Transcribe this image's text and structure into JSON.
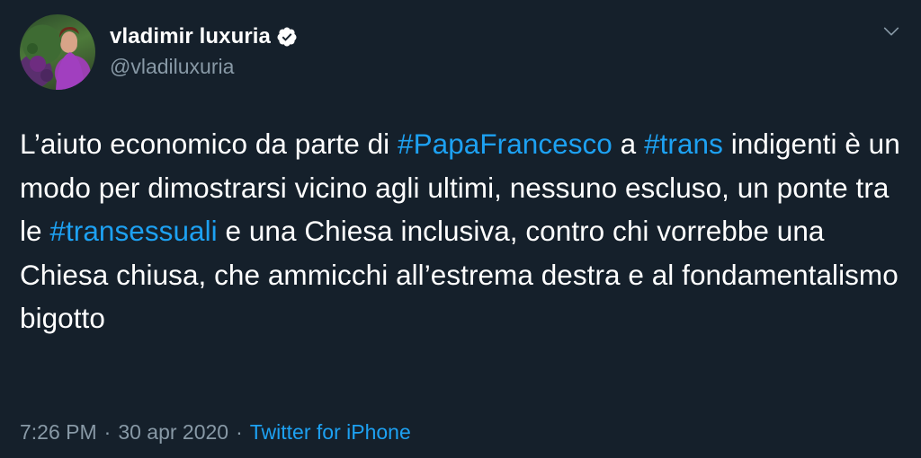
{
  "user": {
    "display_name": "vladimir luxuria",
    "handle": "@vladiluxuria",
    "verified": true
  },
  "tweet": {
    "segments": [
      {
        "text": "L’aiuto economico da parte di ",
        "type": "text"
      },
      {
        "text": "#PapaFrancesco",
        "type": "hashtag"
      },
      {
        "text": " a ",
        "type": "text"
      },
      {
        "text": "#trans",
        "type": "hashtag"
      },
      {
        "text": " indigenti è un modo per dimostrarsi vicino agli ultimi, nessuno escluso, un ponte tra le ",
        "type": "text"
      },
      {
        "text": "#transessuali",
        "type": "hashtag"
      },
      {
        "text": " e una Chiesa inclusiva, contro chi vorrebbe una Chiesa chiusa, che ammicchi all’estrema destra e al fondamentalismo bigotto",
        "type": "text"
      }
    ]
  },
  "meta": {
    "time": "7:26 PM",
    "separator": "·",
    "date": "30 apr 2020",
    "source": "Twitter for iPhone"
  },
  "colors": {
    "background": "#15202b",
    "text": "#ffffff",
    "secondary_text": "#8899a6",
    "link": "#1da1f2"
  },
  "icons": {
    "verified": "verified-badge-icon",
    "menu": "chevron-down-icon"
  }
}
